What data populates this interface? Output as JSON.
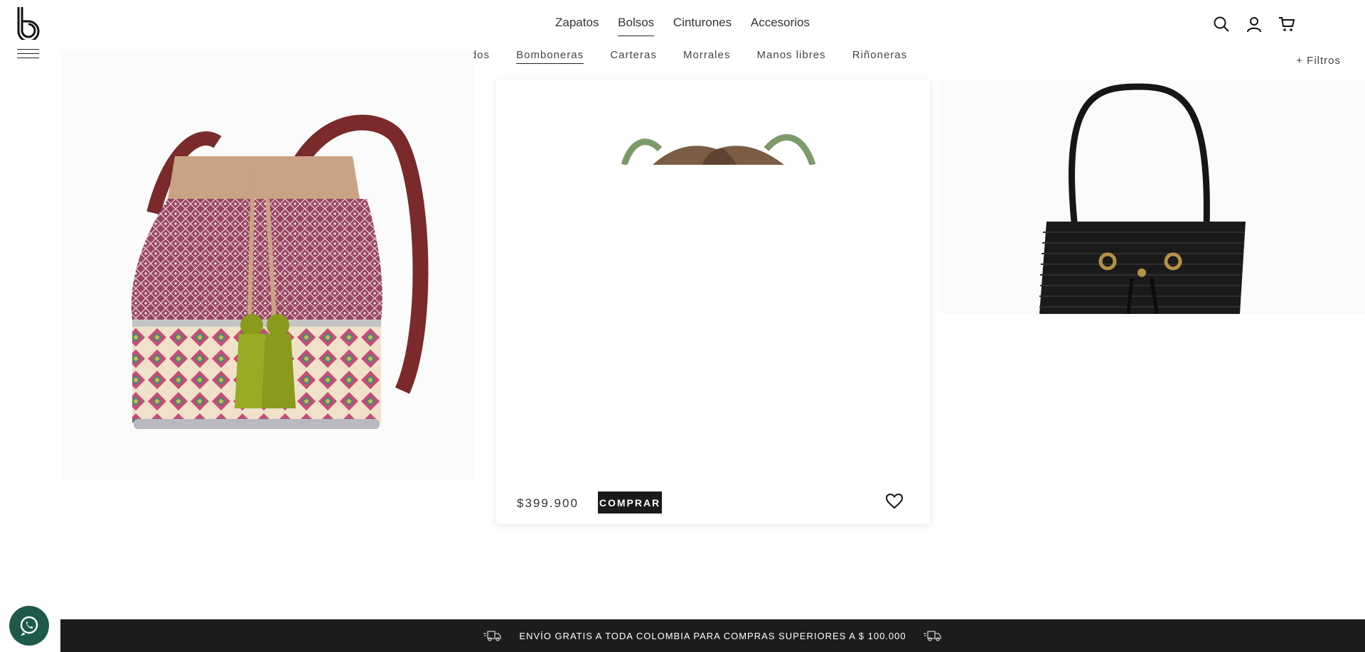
{
  "brand": {
    "logo_letter": "b"
  },
  "main_nav": {
    "items": [
      {
        "label": "Zapatos"
      },
      {
        "label": "Bolsos"
      },
      {
        "label": "Cinturones"
      },
      {
        "label": "Accesorios"
      }
    ],
    "active": "Bolsos"
  },
  "sub_nav": {
    "items": [
      {
        "label": "Todos"
      },
      {
        "label": "Bomboneras"
      },
      {
        "label": "Carteras"
      },
      {
        "label": "Morrales"
      },
      {
        "label": "Manos libres"
      },
      {
        "label": "Riñoneras"
      }
    ],
    "active": "Bomboneras"
  },
  "header_icons": [
    "search-icon",
    "user-icon",
    "cart-icon"
  ],
  "filters_label": "+ Filtros",
  "product_card": {
    "price": "$399.900",
    "buy_label": "COMPRAR"
  },
  "banner": {
    "text": "ENVÍO GRATIS A TODA COLOMBIA PARA COMPRAS SUPERIORES A $ 100.000"
  },
  "colors": {
    "banner_bg": "#1c1c1c",
    "button_bg": "#1a1a1a",
    "whatsapp_bg": "#1d5a4a"
  }
}
